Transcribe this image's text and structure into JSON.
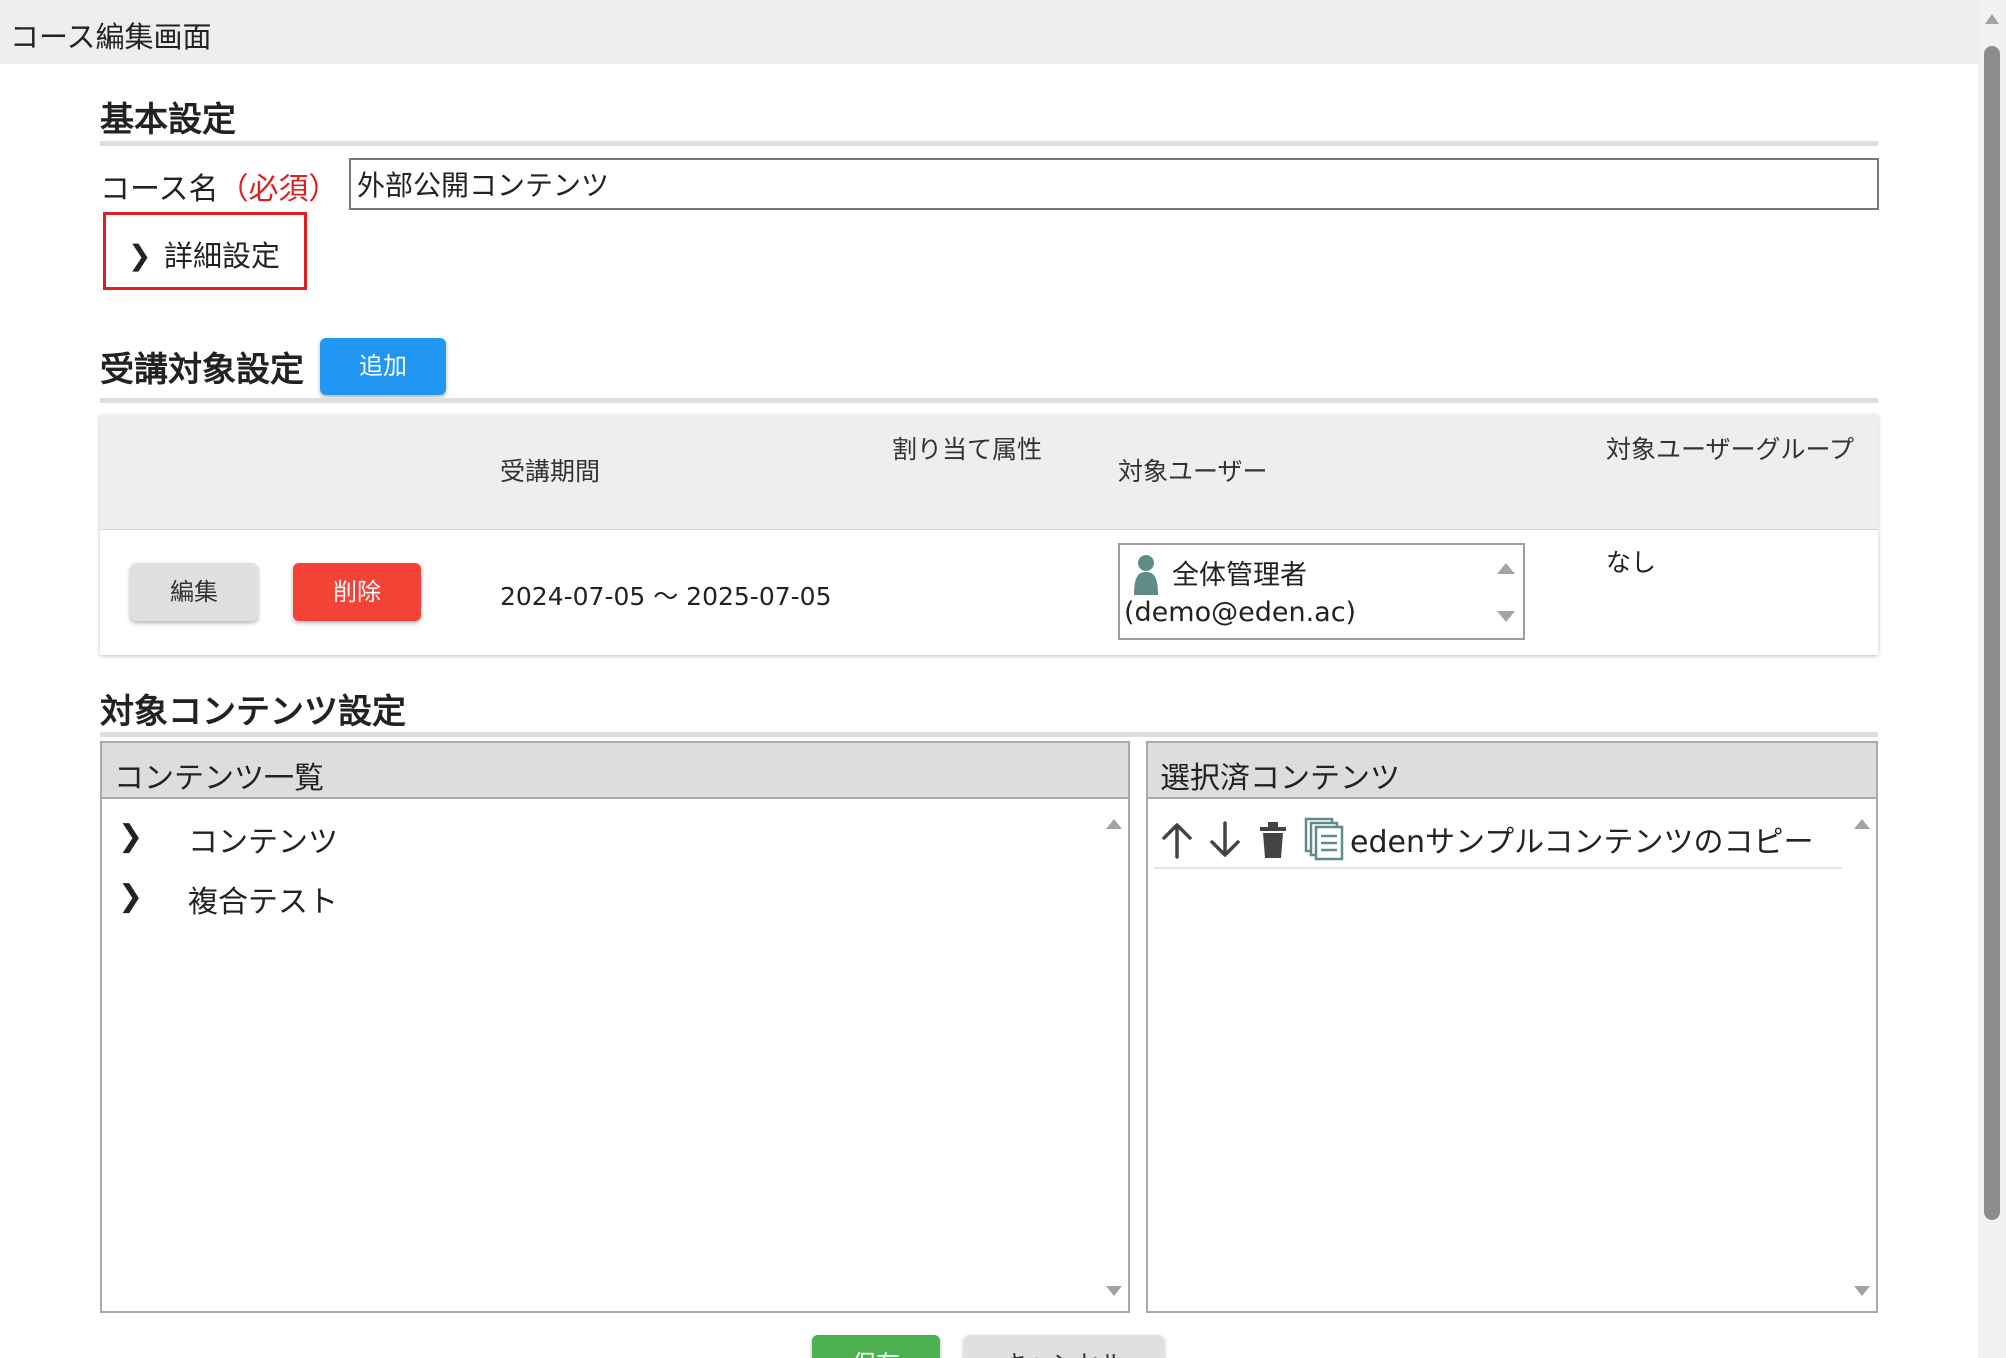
{
  "window": {
    "title": "コース編集画面"
  },
  "basic": {
    "heading": "基本設定",
    "course_label": "コース名",
    "required_mark": "（必須）",
    "course_name_value": "外部公開コンテンツ",
    "detail_toggle_label": "詳細設定"
  },
  "target": {
    "heading": "受講対象設定",
    "add_button": "追加",
    "columns": [
      "",
      "受講期間",
      "割り当て属性",
      "対象ユーザー",
      "対象ユーザーグループ"
    ],
    "rows": [
      {
        "edit_label": "編集",
        "delete_label": "削除",
        "period": "2024-07-05 〜 2025-07-05",
        "attribute": "",
        "user_name": "全体管理者",
        "user_email": "(demo@eden.ac)",
        "user_group": "なし"
      }
    ]
  },
  "contents": {
    "heading": "対象コンテンツ設定",
    "list_panel_title": "コンテンツ一覧",
    "tree_items": [
      "コンテンツ",
      "複合テスト"
    ],
    "selected_panel_title": "選択済コンテンツ",
    "selected_items": [
      "edenサンプルコンテンツのコピー"
    ]
  },
  "footer": {
    "save_label": "保存",
    "cancel_label": "キャンセル"
  },
  "colors": {
    "primary": "#2196f3",
    "danger": "#f44336",
    "success": "#4caf50",
    "highlight_border": "#e02020"
  },
  "icons": [
    "chevron-right-icon",
    "person-icon",
    "arrow-up-icon",
    "arrow-down-icon",
    "trash-icon",
    "copy-content-icon"
  ]
}
